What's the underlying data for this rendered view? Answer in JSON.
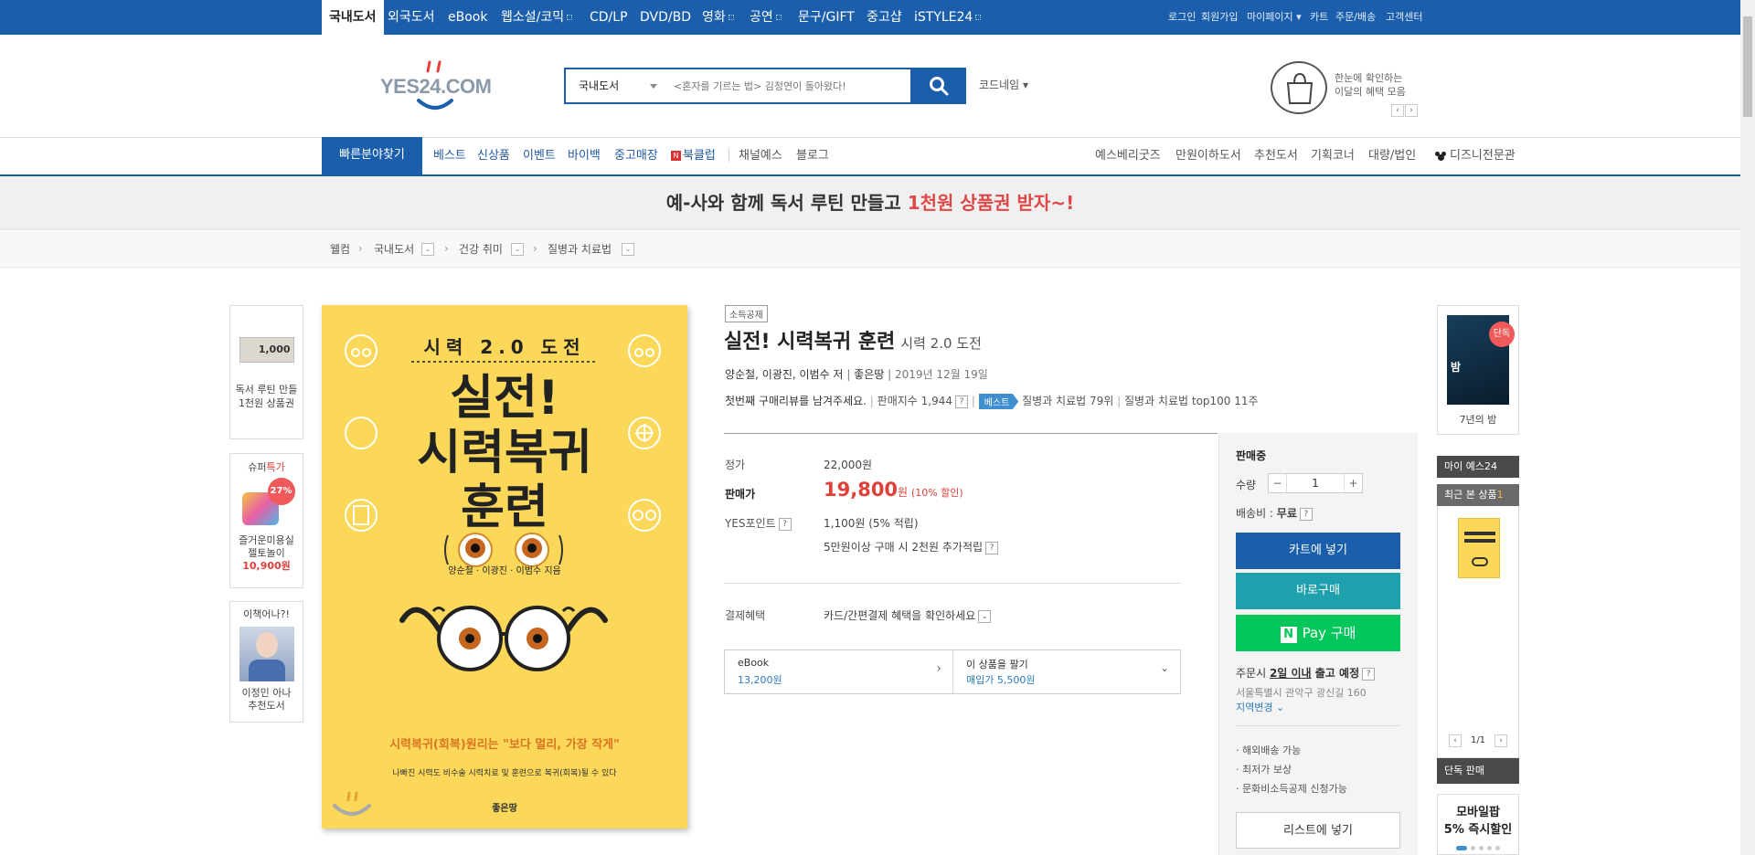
{
  "topbar": {
    "categories": [
      "국내도서",
      "외국도서",
      "eBook",
      "웹소설/코믹",
      "CD/LP",
      "DVD/BD",
      "영화",
      "공연",
      "문구/GIFT",
      "중고샵",
      "iSTYLE24"
    ],
    "util": [
      "로그인",
      "회원가입",
      "마이페이지",
      "카트",
      "주문/배송",
      "고객센터"
    ]
  },
  "header": {
    "logo_text": "YES24.COM",
    "search_scope": "국내도서",
    "search_placeholder": "<혼자를 기르는 법> 김정연이 돌아왔다!",
    "codename": "코드네임",
    "benefit_line1": "한눈에 확인하는",
    "benefit_line2": "이달의 혜택 모음"
  },
  "nav": {
    "quick": "빠른분야찾기",
    "left": [
      "베스트",
      "신상품",
      "이벤트",
      "바이백",
      "중고매장",
      "북클럽",
      "채널예스",
      "블로그"
    ],
    "right": [
      "예스베리굿즈",
      "만원이하도서",
      "추천도서",
      "기획코너",
      "대량/법인",
      "디즈니전문관"
    ]
  },
  "banner": {
    "text_main": "예-사와 함께 독서 루틴 만들고 ",
    "text_red": "1천원 상품권 받자~!"
  },
  "breadcrumb": [
    "웰컴",
    "국내도서",
    "건강 취미",
    "질병과 치료법"
  ],
  "left_rail": {
    "item1_thumb": "1,000",
    "item1_label1": "독서 루틴 만들",
    "item1_label2": "1천원 상품권",
    "item2_title_a": "슈퍼",
    "item2_title_b": "특가",
    "item2_discount": "27%",
    "item2_label1": "즐거운미용실",
    "item2_label2": "젤토놀이",
    "item2_price": "10,900원",
    "item3_title": "이책어나?!",
    "item3_label1": "이정민 아나",
    "item3_label2": "추천도서"
  },
  "cover": {
    "top": "시력 2.0 도전",
    "title1": "실전!",
    "title2": "시력복귀",
    "title3": "훈련",
    "authors": "양순철 · 이광진 · 이범수 지음",
    "tagline": "시력복귀(회복)원리는 \"보다 멀리, 가장 작게\"",
    "subline": "나빠진 시력도 비수술 시력치료 및 훈련으로 복귀(회복)될 수 있다",
    "publisher": "좋은땅"
  },
  "product": {
    "tax_badge": "소득공제",
    "title": "실전! 시력복귀 훈련",
    "subtitle": "시력 2.0 도전",
    "authors": "양순철, 이광진, 이범수 저",
    "publisher": "좋은땅",
    "pubdate": "2019년 12월 19일",
    "review_prompt": "첫번째 구매리뷰를 남겨주세요.",
    "sales_index": "판매지수 1,944",
    "best_flag": "베스트",
    "rank1": "질병과 치료법 79위",
    "rank2": "질병과 치료법 top100 11주",
    "list_label": "정가",
    "list_price": "22,000원",
    "sale_label": "판매가",
    "sale_price": "19,800",
    "sale_unit": "원",
    "discount": "(10% 할인)",
    "points_label": "YES포인트",
    "points": "1,100원 (5% 적립)",
    "extra_points": "5만원이상 구매 시 2천원 추가적립",
    "payment_label": "결제혜택",
    "payment_text": "카드/간편결제 혜택을 확인하세요",
    "ebook_label": "eBook",
    "ebook_price": "13,200원",
    "sell_label": "이 상품을 팔기",
    "sell_price": "매입가 5,500원"
  },
  "panel": {
    "status": "판매중",
    "qty_label": "수량",
    "qty": "1",
    "shipping_label": "배송비 : ",
    "shipping_value": "무료",
    "cart": "카트에 넣기",
    "buy": "바로구매",
    "npay": "Pay 구매",
    "delivery_a": "주문시 ",
    "delivery_b": "2일 이내",
    "delivery_c": " 출고 예정",
    "address": "서울특별시 관악구 광신길 160",
    "region_change": "지역변경",
    "features": [
      "해외배송 가능",
      "최저가 보상",
      "문화비소득공제 신청가능"
    ],
    "wishlist": "리스트에 넣기"
  },
  "right_rail": {
    "exclusive_badge": "단독",
    "book_title": "7년의 밤",
    "my_yes": "마이 예스24",
    "recent": "최근 본 상품",
    "recent_count": "1",
    "page": "1/1",
    "exclusive_sale": "단독 판매",
    "mobile_line1": "모바일팝",
    "mobile_line2": "5% 즉시할인"
  },
  "colors": {
    "brand": "#1b5fac",
    "sale": "#e0403a",
    "teal": "#1fa0ad",
    "npay": "#03c75a"
  }
}
